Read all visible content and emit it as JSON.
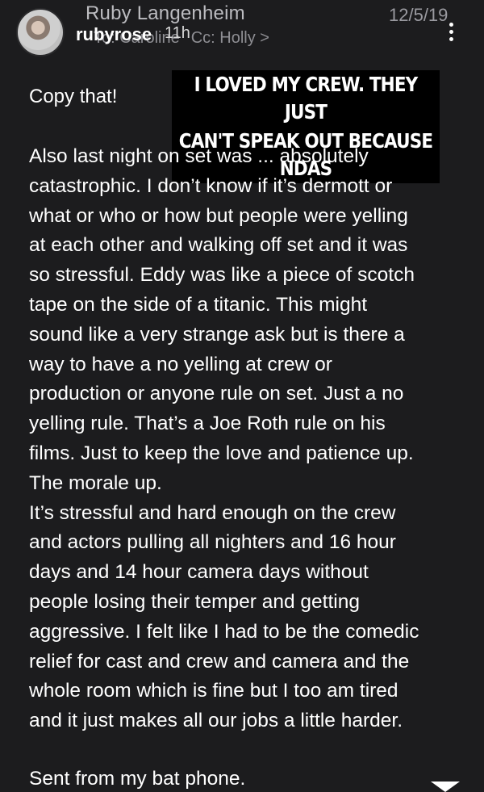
{
  "header": {
    "sender_name": "Ruby Langenheim",
    "date": "12/5/19",
    "to_label": "To: Caroline",
    "cc_label": "Cc: Holly >",
    "icon": "more-vertical-icon"
  },
  "instagram_overlay": {
    "username": "rubyrose",
    "time_ago": "11h"
  },
  "message": {
    "greeting": "Copy that!",
    "caption_lines": [
      "I LOVED MY CREW. THEY JUST",
      "CAN'T SPEAK OUT BECAUSE NDAS"
    ],
    "body_lines": [
      "Also last night on set was ... absolutely",
      "catastrophic. I don’t know if it’s dermott or",
      "what or who or how but people were yelling",
      "at each other and walking off set and it was",
      "so stressful. Eddy was like a piece of scotch",
      "tape on the side of a titanic. This might",
      "sound like a very strange ask but is there a",
      "way to have a no yelling at crew or",
      "production or anyone rule on set. Just a no",
      "yelling rule. That’s a Joe Roth rule on his",
      "films. Just to keep the love and patience up.",
      "The morale up.",
      "It’s stressful and hard enough on the crew",
      "and actors pulling all nighters and 16 hour",
      "days and 14 hour camera days without",
      "people losing their temper and getting",
      "aggressive. I felt like I had to be the comedic",
      "relief for cast and crew and camera and the",
      "whole room which is fine but I too am tired",
      "and it just makes all our jobs a little harder."
    ],
    "signature": "Sent from my bat phone."
  }
}
